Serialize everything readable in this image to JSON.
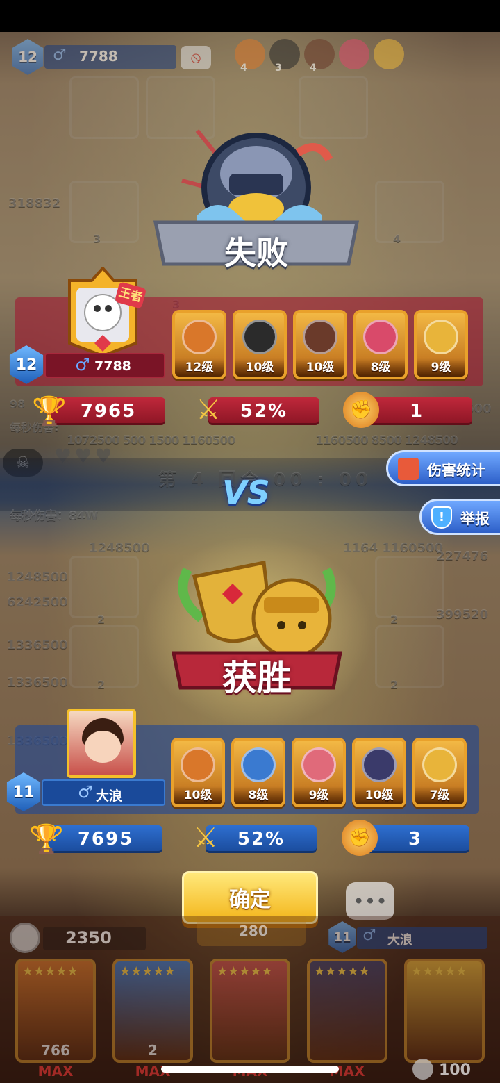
{
  "top_hud": {
    "level": "12",
    "gender_icon": "male-symbol",
    "rating": "7788",
    "hero_stars": [
      "4",
      "3",
      "4"
    ]
  },
  "background_numbers": {
    "left_top": "318832",
    "upper_row": "1072500 500 1500 1160500",
    "upper_row_right": "1160500 8500 1248500",
    "upper_right": "1248500",
    "dps_label_top": "每秒伤害:",
    "dps_label_mid": "每秒伤害：84W",
    "round_label": "第 4 回合 00 : 00",
    "lower_col": [
      "1248500",
      "1248500",
      "6242500",
      "1336500",
      "1336500",
      "1336500"
    ],
    "lower_mid": "1164 1160500",
    "lower_right": [
      "227476",
      "399520"
    ],
    "cell_small_nums": [
      "3",
      "4",
      "3",
      "2",
      "2",
      "2",
      "2"
    ],
    "left_cut": "98"
  },
  "defeat_banner": {
    "text": "失败"
  },
  "victory_banner": {
    "text": "获胜"
  },
  "vs_label": "VS",
  "side_buttons": {
    "damage_stats": "伤害统计",
    "report": "举报"
  },
  "opponent": {
    "rank_badge": "王者",
    "level": "12",
    "name": "7788",
    "heroes": [
      {
        "name": "monkey-king",
        "level": "12级",
        "color": "#d9772a"
      },
      {
        "name": "dark-mage",
        "level": "10级",
        "color": "#2b2b2b"
      },
      {
        "name": "maid-girl",
        "level": "10级",
        "color": "#6a3a2a"
      },
      {
        "name": "clown",
        "level": "8级",
        "color": "#d94a6a"
      },
      {
        "name": "golden-chef",
        "level": "9级",
        "color": "#e8b43a"
      }
    ],
    "trophies": "7965",
    "win_rate": "52%",
    "fist_count": "1"
  },
  "player": {
    "level": "11",
    "name": "大浪",
    "heroes": [
      {
        "name": "monkey-king",
        "level": "10级",
        "color": "#d9772a"
      },
      {
        "name": "pharaoh",
        "level": "8级",
        "color": "#3a7ad0"
      },
      {
        "name": "pig-pirate",
        "level": "9级",
        "color": "#e06a7a"
      },
      {
        "name": "masked-ninja",
        "level": "10级",
        "color": "#3a3a6a"
      },
      {
        "name": "golden-chef",
        "level": "7级",
        "color": "#e8b43a"
      }
    ],
    "trophies": "7695",
    "win_rate": "52%",
    "fist_count": "3"
  },
  "confirm_button": "确定",
  "bottom_hud": {
    "coins": "2350",
    "center_value": "280",
    "level": "11",
    "name": "大浪",
    "card_values": [
      "766",
      "2",
      "",
      "",
      ""
    ],
    "max_label": "MAX",
    "energy": "100"
  },
  "colors": {
    "red_team": "#c0283b",
    "blue_team": "#2e6fd0",
    "gold": "#f5c542"
  }
}
